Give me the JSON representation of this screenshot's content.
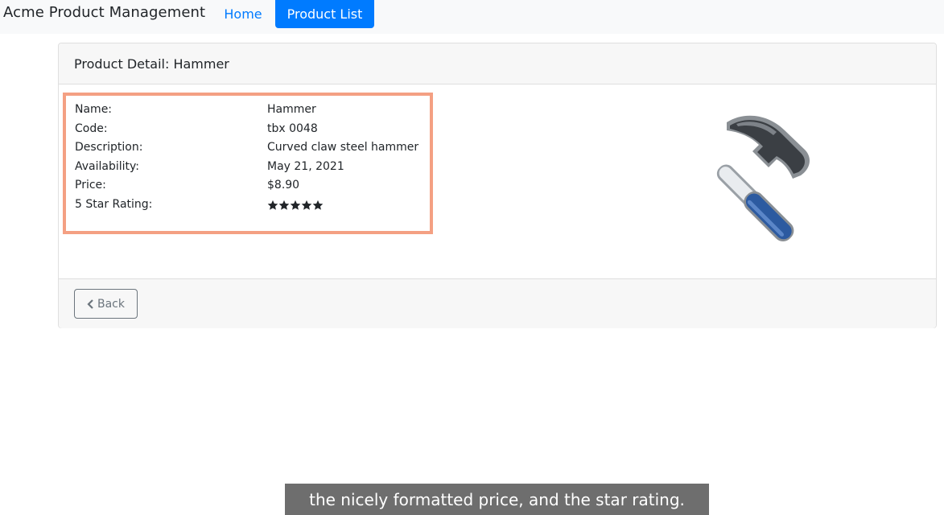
{
  "navbar": {
    "brand": "Acme Product Management",
    "links": [
      {
        "label": "Home",
        "active": false
      },
      {
        "label": "Product List",
        "active": true
      }
    ]
  },
  "card": {
    "title": "Product Detail: Hammer",
    "details": [
      {
        "label": "Name:",
        "value": "Hammer"
      },
      {
        "label": "Code:",
        "value": "tbx 0048"
      },
      {
        "label": "Description:",
        "value": "Curved claw steel hammer"
      },
      {
        "label": "Availability:",
        "value": "May 21, 2021"
      },
      {
        "label": "Price:",
        "value": "$8.90"
      },
      {
        "label": "5 Star Rating:",
        "value": ""
      }
    ],
    "rating_stars": 5,
    "image_icon": "hammer-image",
    "back_label": "Back",
    "back_icon": "chevron-left-icon"
  },
  "caption": "the nicely formatted price, and the star rating.",
  "colors": {
    "primary": "#007bff",
    "highlight": "#f4a083",
    "secondary": "#6c757d"
  }
}
